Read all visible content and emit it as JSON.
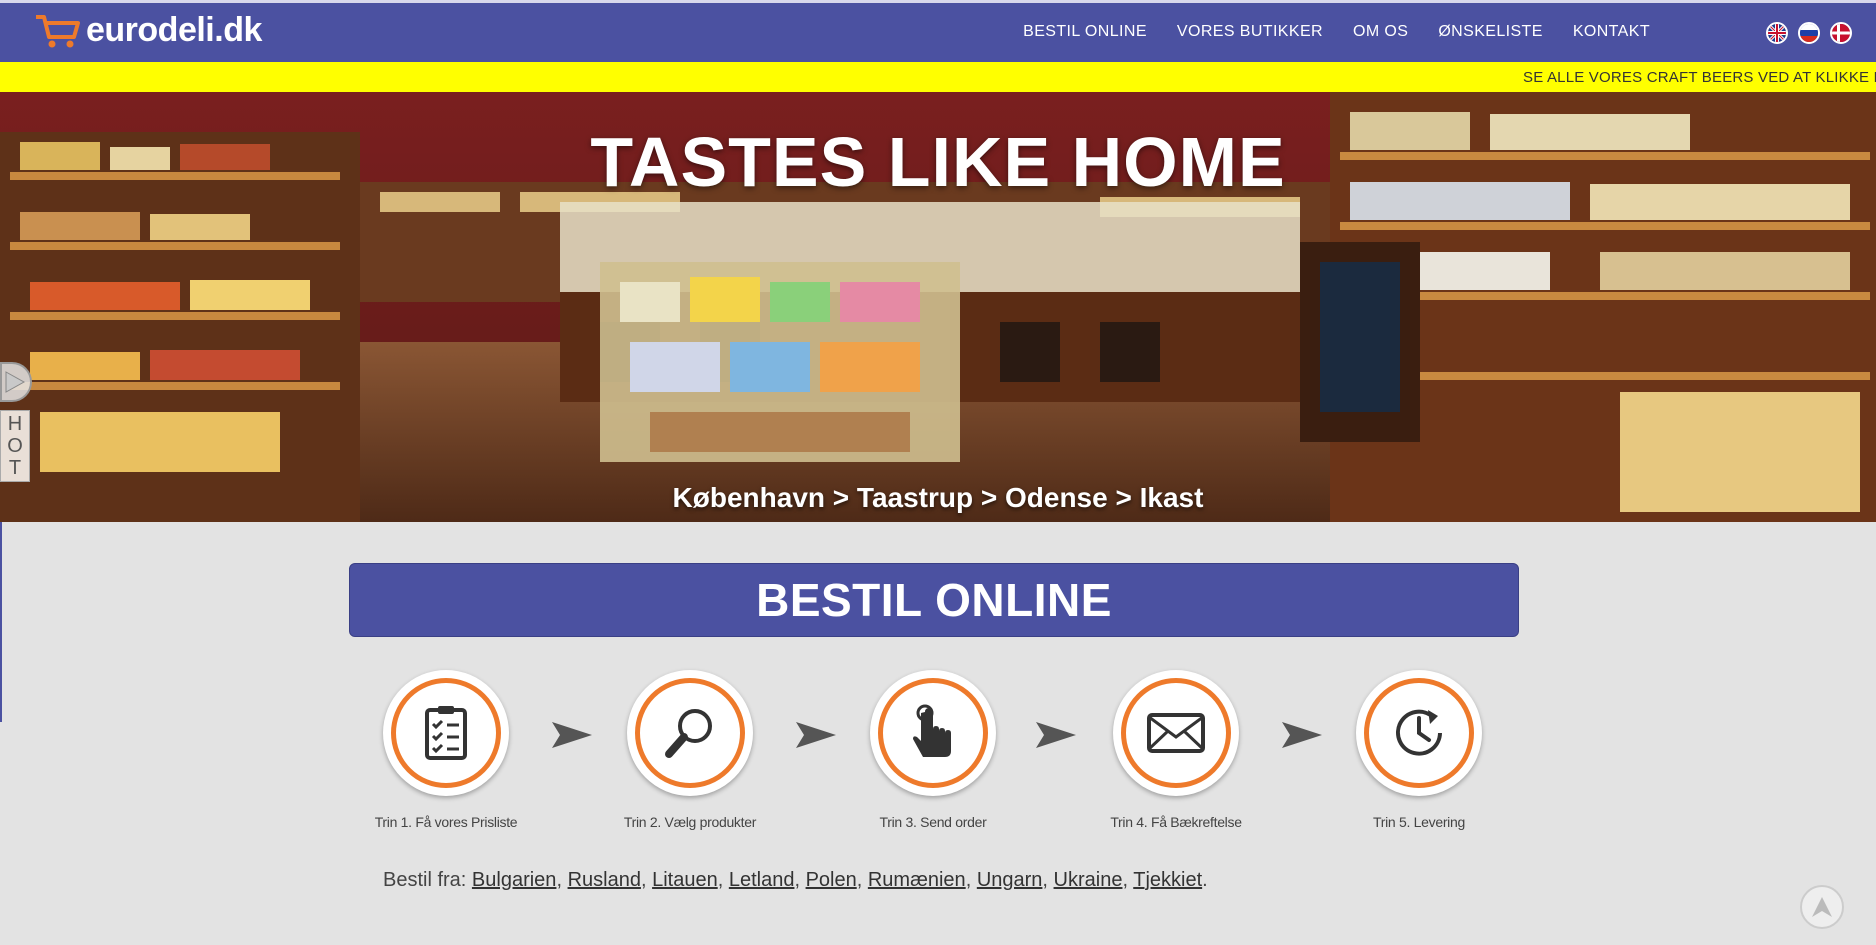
{
  "header": {
    "logo_text": "eurodeli.dk",
    "nav": [
      {
        "label": "BESTIL ONLINE"
      },
      {
        "label": "VORES BUTIKKER"
      },
      {
        "label": "OM OS"
      },
      {
        "label": "ØNSKELISTE"
      },
      {
        "label": "KONTAKT"
      }
    ],
    "flags": [
      "uk-flag-icon",
      "russia-flag-icon",
      "denmark-flag-icon"
    ]
  },
  "ticker": {
    "text": "SE ALLE VORES CRAFT BEERS VED AT KLIKKE P"
  },
  "hero": {
    "title": "TASTES LIKE HOME",
    "cities": "København > Taastrup > Odense > Ikast"
  },
  "side_tab": {
    "label_chars": [
      "H",
      "O",
      "T"
    ]
  },
  "order": {
    "banner_title": "BESTIL ONLINE",
    "steps": [
      {
        "label": "Trin 1. Få vores Prisliste",
        "icon": "clipboard-checklist-icon"
      },
      {
        "label": "Trin 2. Vælg produkter",
        "icon": "magnifier-icon"
      },
      {
        "label": "Trin 3. Send order",
        "icon": "pointer-hand-icon"
      },
      {
        "label": "Trin 4. Få Bækreftelse",
        "icon": "envelope-icon"
      },
      {
        "label": "Trin 5. Levering",
        "icon": "clock-refresh-icon"
      }
    ],
    "from_prefix": "Bestil fra:",
    "countries": [
      "Bulgarien",
      "Rusland",
      "Litauen",
      "Letland",
      "Polen",
      "Rumænien",
      "Ungarn",
      "Ukraine",
      "Tjekkiet"
    ]
  },
  "colors": {
    "brand": "#4b51a1",
    "accent": "#ee7a2b",
    "ticker": "#ffff00"
  }
}
